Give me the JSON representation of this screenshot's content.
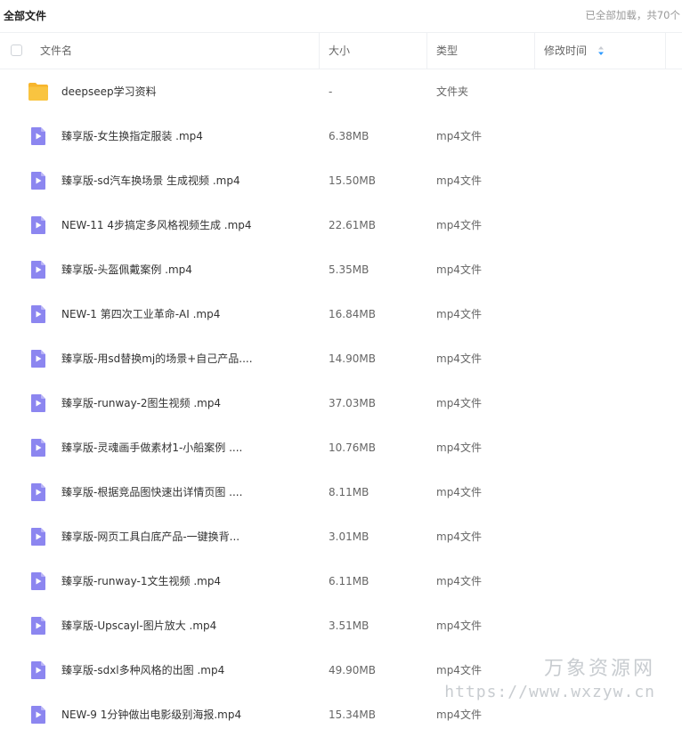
{
  "topbar": {
    "title": "全部文件",
    "status": "已全部加载，共70个"
  },
  "header": {
    "col_name": "文件名",
    "col_size": "大小",
    "col_type": "类型",
    "col_modified": "修改时间",
    "sort_icon": "sort-desc-icon"
  },
  "colors": {
    "folder": "#f9c440",
    "video": "#8c86f0",
    "sort_active": "#2f9bff"
  },
  "files": [
    {
      "icon": "folder-icon",
      "name": "deepseep学习资料",
      "size": "-",
      "type": "文件夹"
    },
    {
      "icon": "video-file-icon",
      "name": "臻享版-女生换指定服装 .mp4",
      "size": "6.38MB",
      "type": "mp4文件"
    },
    {
      "icon": "video-file-icon",
      "name": "臻享版-sd汽车换场景 生成视频 .mp4",
      "size": "15.50MB",
      "type": "mp4文件"
    },
    {
      "icon": "video-file-icon",
      "name": "NEW-11 4步搞定多风格视频生成 .mp4",
      "size": "22.61MB",
      "type": "mp4文件"
    },
    {
      "icon": "video-file-icon",
      "name": "臻享版-头盔佩戴案例 .mp4",
      "size": "5.35MB",
      "type": "mp4文件"
    },
    {
      "icon": "video-file-icon",
      "name": "NEW-1 第四次工业革命-AI .mp4",
      "size": "16.84MB",
      "type": "mp4文件"
    },
    {
      "icon": "video-file-icon",
      "name": "臻享版-用sd替换mj的场景+自己产品....",
      "size": "14.90MB",
      "type": "mp4文件"
    },
    {
      "icon": "video-file-icon",
      "name": "臻享版-runway-2图生视频 .mp4",
      "size": "37.03MB",
      "type": "mp4文件"
    },
    {
      "icon": "video-file-icon",
      "name": "臻享版-灵魂画手做素材1-小船案例 ....",
      "size": "10.76MB",
      "type": "mp4文件"
    },
    {
      "icon": "video-file-icon",
      "name": "臻享版-根据竞品图快速出详情页图 ....",
      "size": "8.11MB",
      "type": "mp4文件"
    },
    {
      "icon": "video-file-icon",
      "name": "臻享版-网页工具白底产品-一键换背...",
      "size": "3.01MB",
      "type": "mp4文件"
    },
    {
      "icon": "video-file-icon",
      "name": "臻享版-runway-1文生视频 .mp4",
      "size": "6.11MB",
      "type": "mp4文件"
    },
    {
      "icon": "video-file-icon",
      "name": "臻享版-Upscayl-图片放大 .mp4",
      "size": "3.51MB",
      "type": "mp4文件"
    },
    {
      "icon": "video-file-icon",
      "name": "臻享版-sdxl多种风格的出图 .mp4",
      "size": "49.90MB",
      "type": "mp4文件"
    },
    {
      "icon": "video-file-icon",
      "name": "NEW-9 1分钟做出电影级别海报.mp4",
      "size": "15.34MB",
      "type": "mp4文件"
    }
  ],
  "watermark": {
    "title": "万象资源网",
    "url": "https://www.wxzyw.cn"
  }
}
